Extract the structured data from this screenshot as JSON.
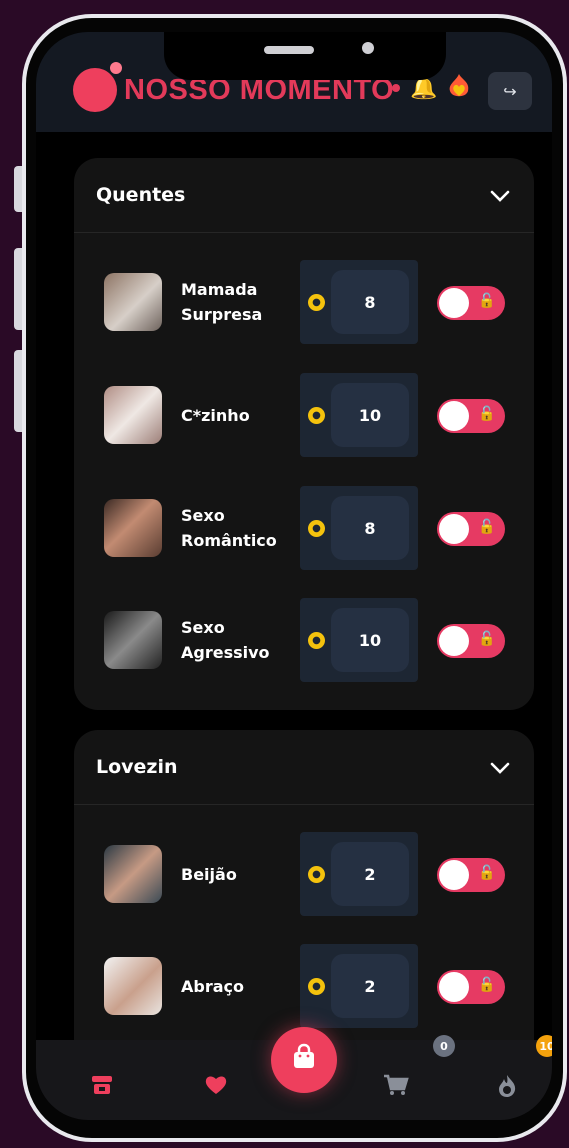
{
  "header": {
    "brand": "NOSSO MOMENTO",
    "logo_icon": "heart-circle",
    "bell_icon": "bell",
    "flame_icon": "flaming-heart",
    "logout_icon": "sign-out",
    "brand_color": "#e33a5a"
  },
  "sections": [
    {
      "title": "Quentes",
      "collapse_icon": "chevron-down",
      "items": [
        {
          "label": "Mamada Surpresa",
          "price": "8",
          "toggle_on": true
        },
        {
          "label": "C*zinho",
          "price": "10",
          "toggle_on": true
        },
        {
          "label": "Sexo Romântico",
          "price": "8",
          "toggle_on": true
        },
        {
          "label": "Sexo Agressivo",
          "price": "10",
          "toggle_on": true
        }
      ]
    },
    {
      "title": "Lovezin",
      "collapse_icon": "chevron-down",
      "items": [
        {
          "label": "Beijão",
          "price": "2",
          "toggle_on": true
        },
        {
          "label": "Abraço",
          "price": "2",
          "toggle_on": true
        }
      ]
    }
  ],
  "tabbar": {
    "tabs": [
      {
        "icon": "store",
        "color": "#ee3f5d"
      },
      {
        "icon": "heart",
        "color": "#ee3f5d"
      },
      {
        "icon": "shopping-bag",
        "color": "#ffffff"
      },
      {
        "icon": "cart",
        "color": "#8a8f99"
      },
      {
        "icon": "fire",
        "color": "#8a8f99"
      }
    ],
    "cart_badge": "0",
    "fire_badge": "10"
  },
  "colors": {
    "accent": "#ee3f5d",
    "toggle": "#e63a63",
    "coin": "#f4c20d",
    "price_box": "#1d2633"
  }
}
